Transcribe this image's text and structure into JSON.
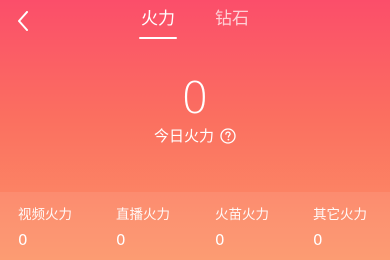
{
  "tabs": [
    {
      "label": "火力",
      "active": true
    },
    {
      "label": "钻石",
      "active": false
    }
  ],
  "hero": {
    "value": "0",
    "label": "今日火力"
  },
  "stats": [
    {
      "label": "视频火力",
      "value": "0"
    },
    {
      "label": "直播火力",
      "value": "0"
    },
    {
      "label": "火苗火力",
      "value": "0"
    },
    {
      "label": "其它火力",
      "value": "0"
    }
  ],
  "icons": {
    "back": "back-icon",
    "help": "help-icon"
  },
  "colors": {
    "gradient_top": "#fb4e6a",
    "gradient_bottom": "#fc9467",
    "text": "#ffffff"
  }
}
